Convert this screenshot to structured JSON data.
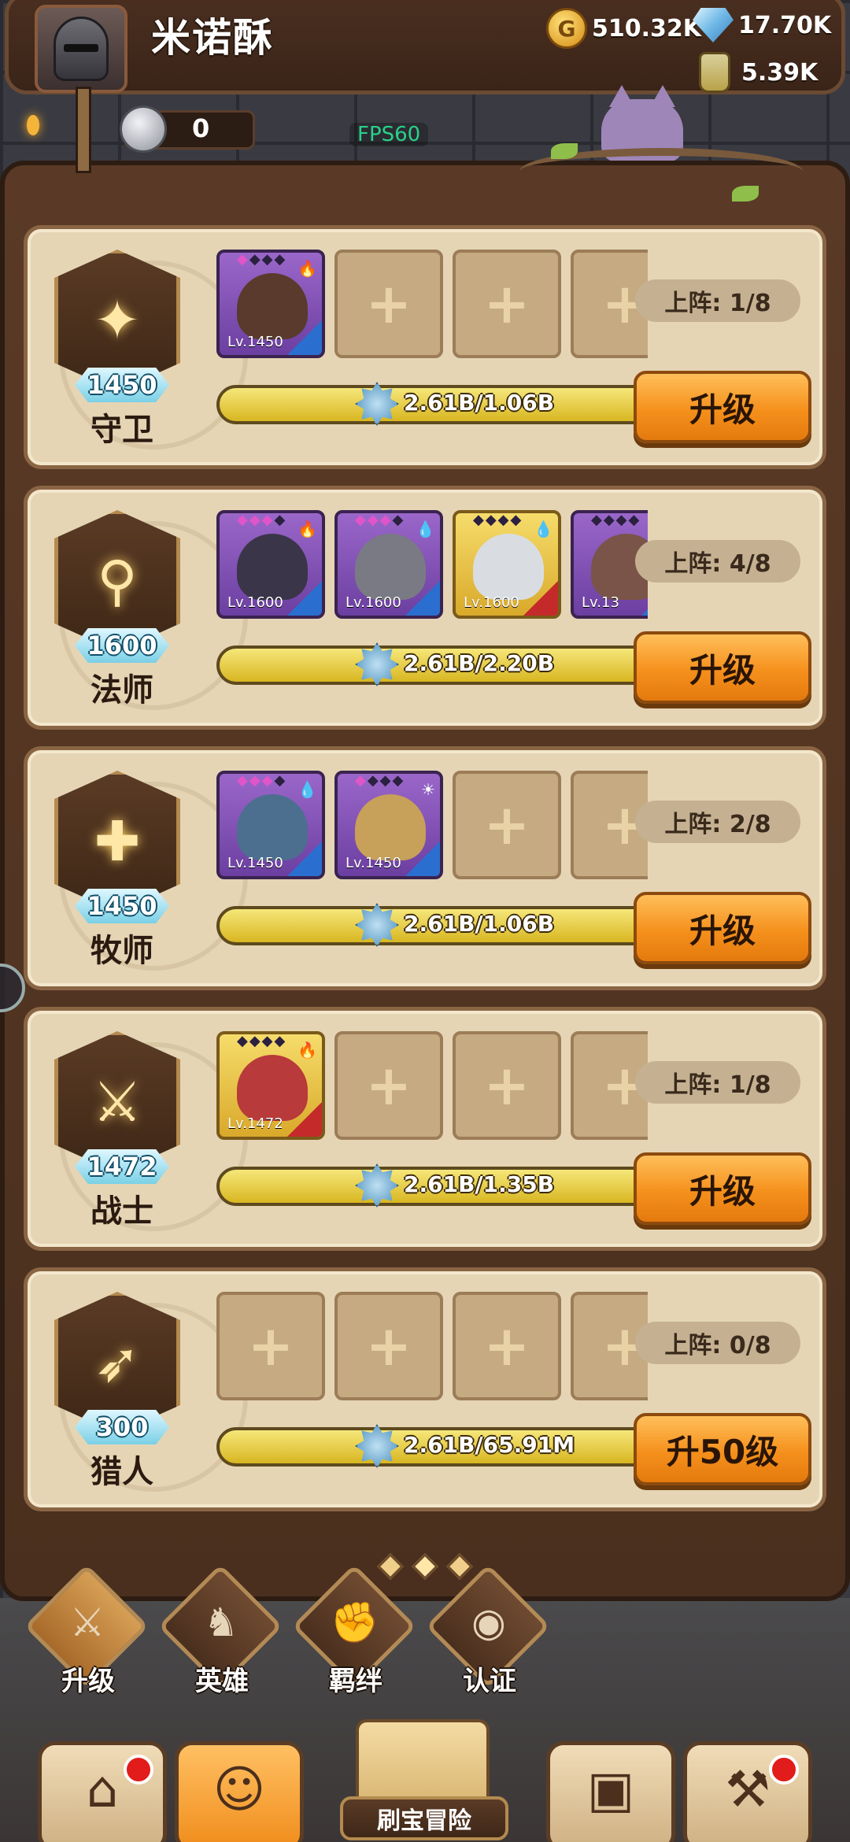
{
  "header": {
    "player_name": "米诺酥",
    "gold": "510.32K",
    "gems": "17.70K",
    "potion": "5.39K",
    "silver": "0",
    "fps": "FPS60"
  },
  "classes": [
    {
      "name": "守卫",
      "level": "1450",
      "icon": "shield-icon",
      "deploy": "上阵: 1/8",
      "progress": "2.61B/1.06B",
      "button": "升级",
      "heroes": [
        {
          "lv": "Lv.1450",
          "frame": "purple",
          "face_color": "#5a3a2c",
          "element": "🔥",
          "stars_filled": 1
        }
      ]
    },
    {
      "name": "法师",
      "level": "1600",
      "icon": "staff-icon",
      "deploy": "上阵: 4/8",
      "progress": "2.61B/2.20B",
      "button": "升级",
      "heroes": [
        {
          "lv": "Lv.1600",
          "frame": "purple",
          "face_color": "#3a3548",
          "element": "🔥",
          "stars_filled": 3
        },
        {
          "lv": "Lv.1600",
          "frame": "purple",
          "face_color": "#7a7a84",
          "element": "💧",
          "stars_filled": 3
        },
        {
          "lv": "Lv.1600",
          "frame": "gold",
          "face_color": "#d9dde2",
          "element": "💧",
          "stars_filled": 0
        },
        {
          "lv": "Lv.13",
          "frame": "purple",
          "face_color": "#7a5448",
          "element": "",
          "stars_filled": 0
        }
      ]
    },
    {
      "name": "牧师",
      "level": "1450",
      "icon": "cross-icon",
      "deploy": "上阵: 2/8",
      "progress": "2.61B/1.06B",
      "button": "升级",
      "heroes": [
        {
          "lv": "Lv.1450",
          "frame": "purple",
          "face_color": "#4c6f8f",
          "element": "💧",
          "stars_filled": 3
        },
        {
          "lv": "Lv.1450",
          "frame": "purple",
          "face_color": "#c7a05a",
          "element": "☀",
          "stars_filled": 1
        }
      ]
    },
    {
      "name": "战士",
      "level": "1472",
      "icon": "sword-icon",
      "deploy": "上阵: 1/8",
      "progress": "2.61B/1.35B",
      "button": "升级",
      "heroes": [
        {
          "lv": "Lv.1472",
          "frame": "gold",
          "face_color": "#b83a3a",
          "element": "🔥",
          "stars_filled": 0
        }
      ]
    },
    {
      "name": "猎人",
      "level": "300",
      "icon": "bow-icon",
      "deploy": "上阵: 0/8",
      "progress": "2.61B/65.91M",
      "button": "升50级",
      "heroes": []
    }
  ],
  "subnav": [
    {
      "label": "升级",
      "icon": "upgrade-icon",
      "glyph": "⚔",
      "active": true
    },
    {
      "label": "英雄",
      "icon": "hero-icon",
      "glyph": "♞",
      "active": false
    },
    {
      "label": "羁绊",
      "icon": "bond-icon",
      "glyph": "✊",
      "active": false
    },
    {
      "label": "认证",
      "icon": "eye-icon",
      "glyph": "◉",
      "active": false
    }
  ],
  "tabs": [
    {
      "icon": "shop-icon",
      "glyph": "⌂",
      "badge": true,
      "active": false
    },
    {
      "icon": "hero-portrait-icon",
      "glyph": "☺",
      "badge": false,
      "active": true
    },
    {
      "icon": "backpack-icon",
      "glyph": "▣",
      "badge": false,
      "active": false
    },
    {
      "icon": "forge-icon",
      "glyph": "⚒",
      "badge": true,
      "active": false
    }
  ],
  "adventure_label": "刷宝冒险"
}
